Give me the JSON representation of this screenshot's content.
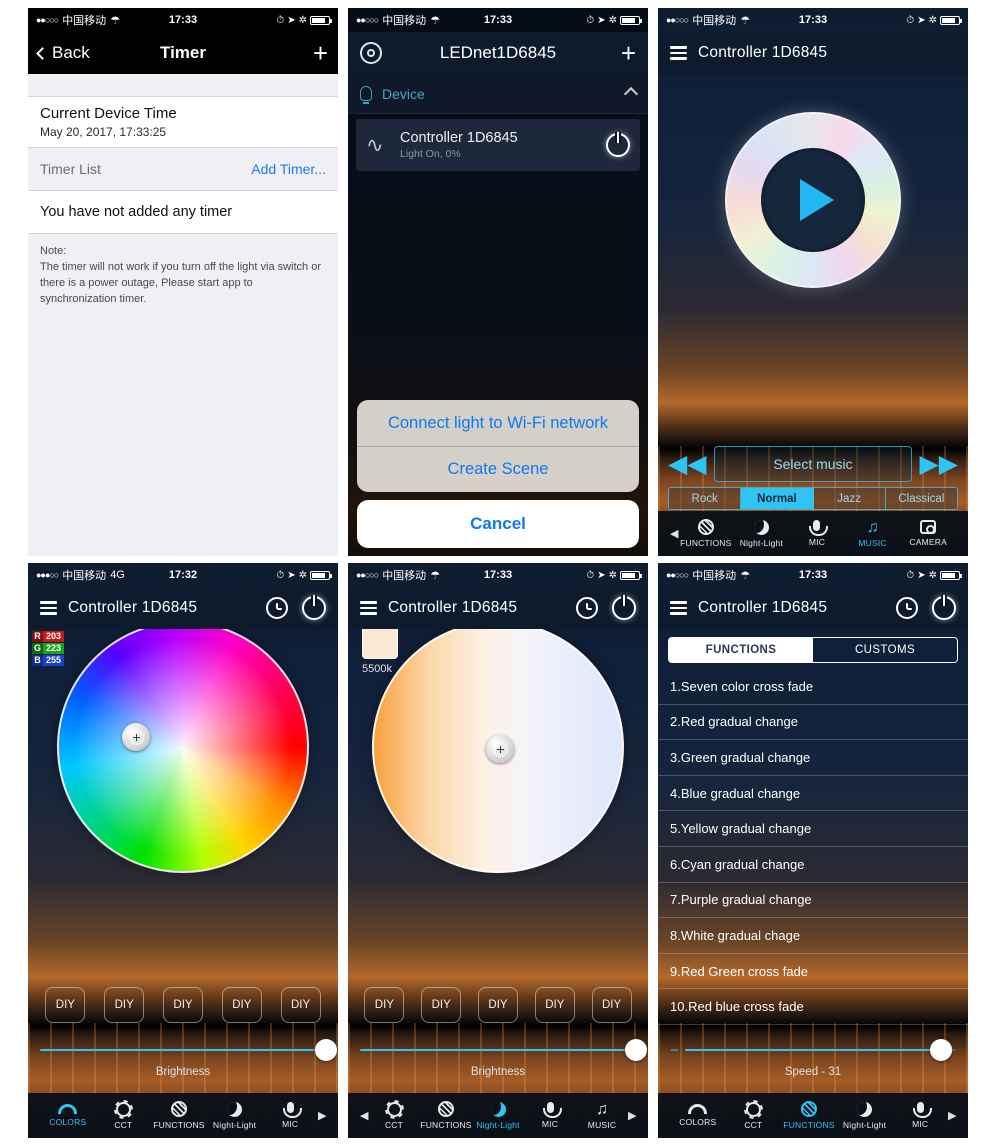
{
  "panels": {
    "timer": {
      "status": {
        "dots": "●●○○○",
        "carrier": "中国移动",
        "network": "",
        "time": "17:33"
      },
      "nav": {
        "back": "Back",
        "title": "Timer",
        "add": "+"
      },
      "device_time_label": "Current Device Time",
      "device_time_value": "May 20, 2017, 17:33:25",
      "list_header": "Timer List",
      "add_timer": "Add Timer...",
      "empty_text": "You have not added any timer",
      "note_title": "Note:",
      "note_body": "The timer will not work if you turn off the light via switch or there is a power outage, Please start app to synchronization timer."
    },
    "lednet": {
      "status": {
        "dots": "●●○○○",
        "carrier": "中国移动",
        "time": "17:33"
      },
      "nav": {
        "title": "LEDnet1D6845",
        "add": "+"
      },
      "section": "Device",
      "device": {
        "name": "Controller 1D6845",
        "status": "Light On, 0%"
      },
      "sheet": {
        "connect": "Connect light to Wi-Fi network",
        "create_scene": "Create Scene",
        "cancel": "Cancel"
      }
    },
    "music": {
      "status": {
        "dots": "●●○○○",
        "carrier": "中国移动",
        "time": "17:33"
      },
      "title": "Controller 1D6845",
      "select_music": "Select music",
      "prev": "◀◀",
      "next": "▶▶",
      "genres": [
        "Rock",
        "Normal",
        "Jazz",
        "Classical"
      ],
      "genre_active": "Normal",
      "tabs": [
        {
          "label": "FUNCTIONS",
          "icon": "functions-icon",
          "active": false
        },
        {
          "label": "Night-Light",
          "icon": "moon-icon",
          "active": false
        },
        {
          "label": "MIC",
          "icon": "mic-icon",
          "active": false
        },
        {
          "label": "MUSIC",
          "icon": "music-note-icon",
          "active": true
        },
        {
          "label": "CAMERA",
          "icon": "camera-icon",
          "active": false
        }
      ]
    },
    "colors": {
      "status": {
        "dots": "●●●○○",
        "carrier": "中国移动",
        "network": "4G",
        "time": "17:32"
      },
      "title": "Controller 1D6845",
      "rgb": {
        "r_key": "R",
        "r": "203",
        "g_key": "G",
        "g": "223",
        "b_key": "B",
        "b": "255"
      },
      "diy": [
        "DIY",
        "DIY",
        "DIY",
        "DIY",
        "DIY"
      ],
      "slider_label": "Brightness",
      "tabs": [
        {
          "label": "COLORS",
          "icon": "rainbow-icon",
          "active": true
        },
        {
          "label": "CCT",
          "icon": "sun-icon",
          "active": false
        },
        {
          "label": "FUNCTIONS",
          "icon": "functions-icon",
          "active": false
        },
        {
          "label": "Night-Light",
          "icon": "moon-icon",
          "active": false
        },
        {
          "label": "MIC",
          "icon": "mic-icon",
          "active": false
        }
      ]
    },
    "cct": {
      "status": {
        "dots": "●●○○○",
        "carrier": "中国移动",
        "time": "17:33"
      },
      "title": "Controller 1D6845",
      "kelvin": "5500k",
      "diy": [
        "DIY",
        "DIY",
        "DIY",
        "DIY",
        "DIY"
      ],
      "slider_label": "Brightness",
      "tabs": [
        {
          "label": "CCT",
          "icon": "sun-icon",
          "active": false
        },
        {
          "label": "FUNCTIONS",
          "icon": "functions-icon",
          "active": false
        },
        {
          "label": "Night-Light",
          "icon": "moon-icon",
          "active": true
        },
        {
          "label": "MIC",
          "icon": "mic-icon",
          "active": false
        },
        {
          "label": "MUSIC",
          "icon": "music-note-icon",
          "active": false
        }
      ]
    },
    "functions": {
      "status": {
        "dots": "●●○○○",
        "carrier": "中国移动",
        "time": "17:33"
      },
      "title": "Controller 1D6845",
      "segments": [
        "FUNCTIONS",
        "CUSTOMS"
      ],
      "segment_active": "FUNCTIONS",
      "items": [
        "1.Seven color cross fade",
        "2.Red gradual change",
        "3.Green gradual change",
        "4.Blue gradual change",
        "5.Yellow gradual change",
        "6.Cyan gradual change",
        "7.Purple gradual change",
        "8.White gradual chage",
        "9.Red Green cross fade",
        "10.Red blue cross fade"
      ],
      "speed_label": "Speed - 31",
      "minus": "−",
      "plus": "+",
      "tabs": [
        {
          "label": "COLORS",
          "icon": "rainbow-icon",
          "active": false
        },
        {
          "label": "CCT",
          "icon": "sun-icon",
          "active": false
        },
        {
          "label": "FUNCTIONS",
          "icon": "functions-icon",
          "active": true
        },
        {
          "label": "Night-Light",
          "icon": "moon-icon",
          "active": false
        },
        {
          "label": "MIC",
          "icon": "mic-icon",
          "active": false
        }
      ]
    }
  }
}
